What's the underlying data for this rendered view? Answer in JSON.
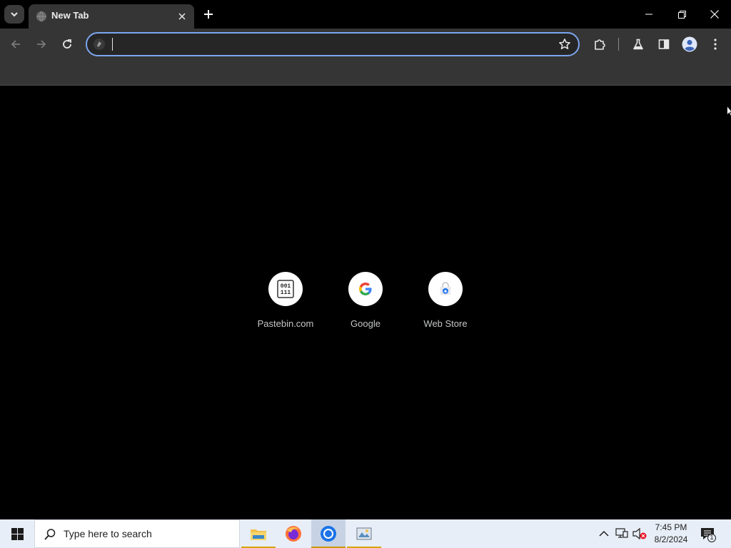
{
  "tab": {
    "title": "New Tab"
  },
  "omnibox": {
    "value": "",
    "placeholder": ""
  },
  "shortcuts": [
    {
      "label": "Pastebin.com",
      "icon": "pastebin-icon"
    },
    {
      "label": "Google",
      "icon": "google-icon"
    },
    {
      "label": "Web Store",
      "icon": "web-store-icon"
    }
  ],
  "taskbar": {
    "search_placeholder": "Type here to search",
    "apps": [
      "file-explorer-icon",
      "firefox-icon",
      "chrome-icon",
      "image-app-icon"
    ],
    "clock": {
      "time": "7:45 PM",
      "date": "8/2/2024"
    },
    "notification_count": "1"
  },
  "colors": {
    "tab_bg": "#353535",
    "toolbar_bg": "#353535",
    "omnibox_focus_ring": "#7ca5ee",
    "content_bg": "#000000",
    "taskbar_bg": "#e8eef7",
    "shortcut_label": "#c4c7c5"
  }
}
